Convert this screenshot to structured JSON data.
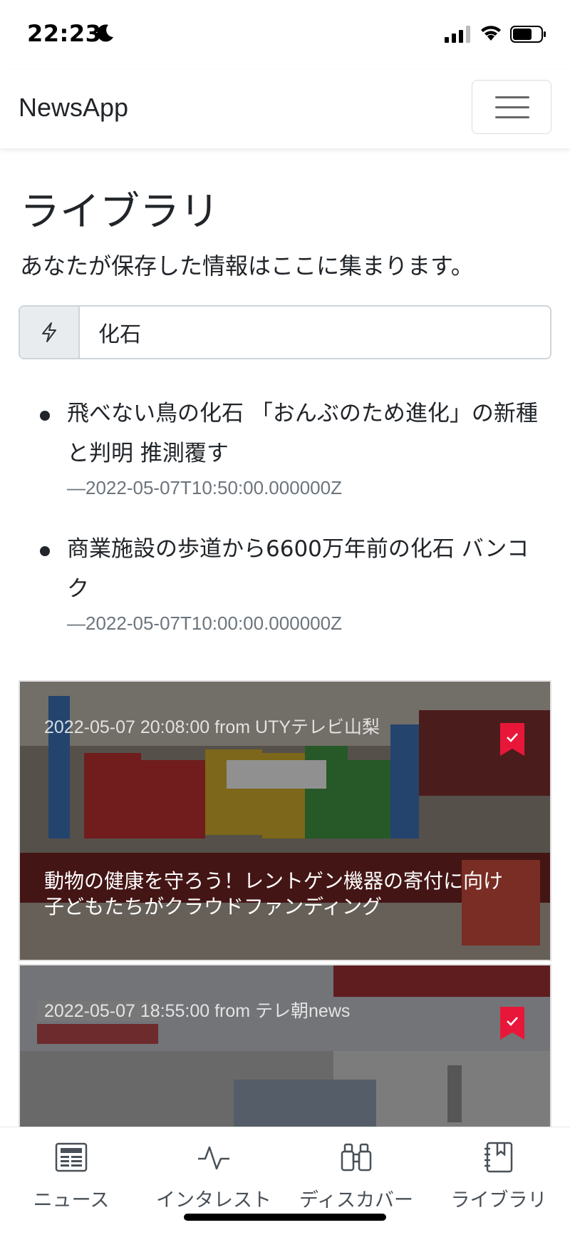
{
  "status_bar": {
    "time": "22:23"
  },
  "navbar": {
    "brand": "NewsApp"
  },
  "page": {
    "title": "ライブラリ",
    "subtitle": "あなたが保存した情報はここに集まります。"
  },
  "search": {
    "value": "化石",
    "icon": "lightning-icon"
  },
  "results": [
    {
      "title": "飛べない鳥の化石 「おんぶのため進化」の新種と判明 推測覆す",
      "date": "2022-05-07T10:50:00.000000Z"
    },
    {
      "title": "商業施設の歩道から6600万年前の化石 バンコク",
      "date": "2022-05-07T10:00:00.000000Z"
    }
  ],
  "cards": [
    {
      "meta": "2022-05-07 20:08:00 from UTYテレビ山梨",
      "title": "動物の健康を守ろう！レントゲン機器の寄付に向け 子どもたちがクラウドファンディング",
      "bookmarked": true
    },
    {
      "meta": "2022-05-07 18:55:00 from テレ朝news",
      "title": "",
      "bookmarked": true
    }
  ],
  "tabs": [
    {
      "label": "ニュース",
      "icon": "newspaper-icon"
    },
    {
      "label": "インタレスト",
      "icon": "activity-icon"
    },
    {
      "label": "ディスカバー",
      "icon": "binoculars-icon"
    },
    {
      "label": "ライブラリ",
      "icon": "journal-icon"
    }
  ],
  "colors": {
    "accent_red": "#e8173a",
    "muted_text": "#6c757d",
    "input_border": "#ced4da"
  }
}
